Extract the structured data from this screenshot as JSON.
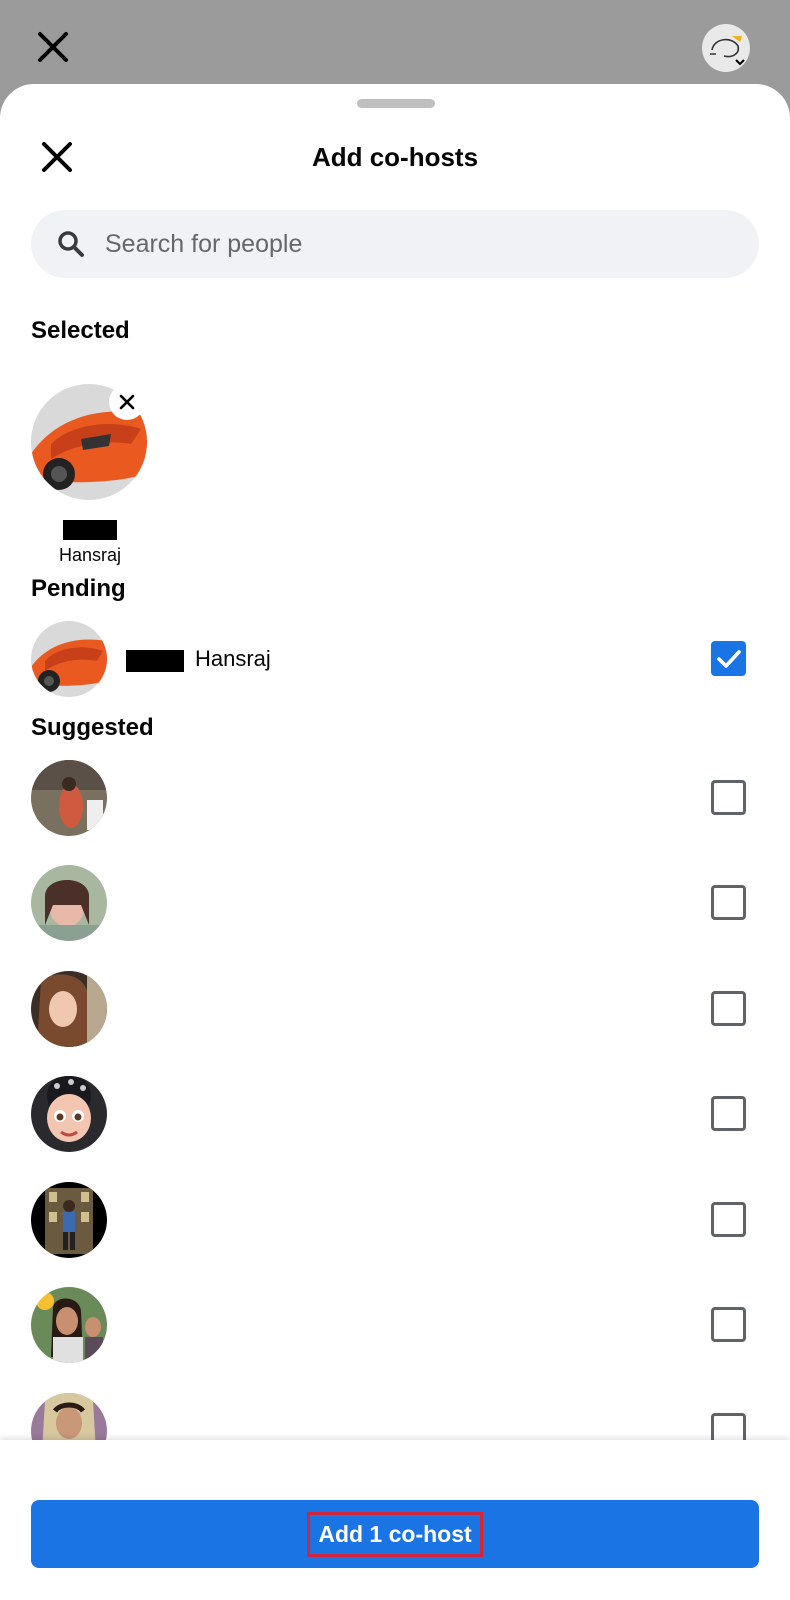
{
  "sheet": {
    "title": "Add co-hosts"
  },
  "search": {
    "placeholder": "Search for people"
  },
  "sections": {
    "selected": "Selected",
    "pending": "Pending",
    "suggested": "Suggested"
  },
  "selected_people": [
    {
      "name": "Hansraj"
    }
  ],
  "pending_people": [
    {
      "name": "Hansraj",
      "checked": true
    }
  ],
  "suggested_people": [
    {
      "checked": false
    },
    {
      "checked": false
    },
    {
      "checked": false
    },
    {
      "checked": false
    },
    {
      "checked": false
    },
    {
      "checked": false
    },
    {
      "checked": false
    }
  ],
  "footer": {
    "button_label": "Add 1 co-host"
  },
  "colors": {
    "accent": "#1b74e4",
    "highlight_box": "#d0253a",
    "search_bg": "#f0f2f5"
  }
}
